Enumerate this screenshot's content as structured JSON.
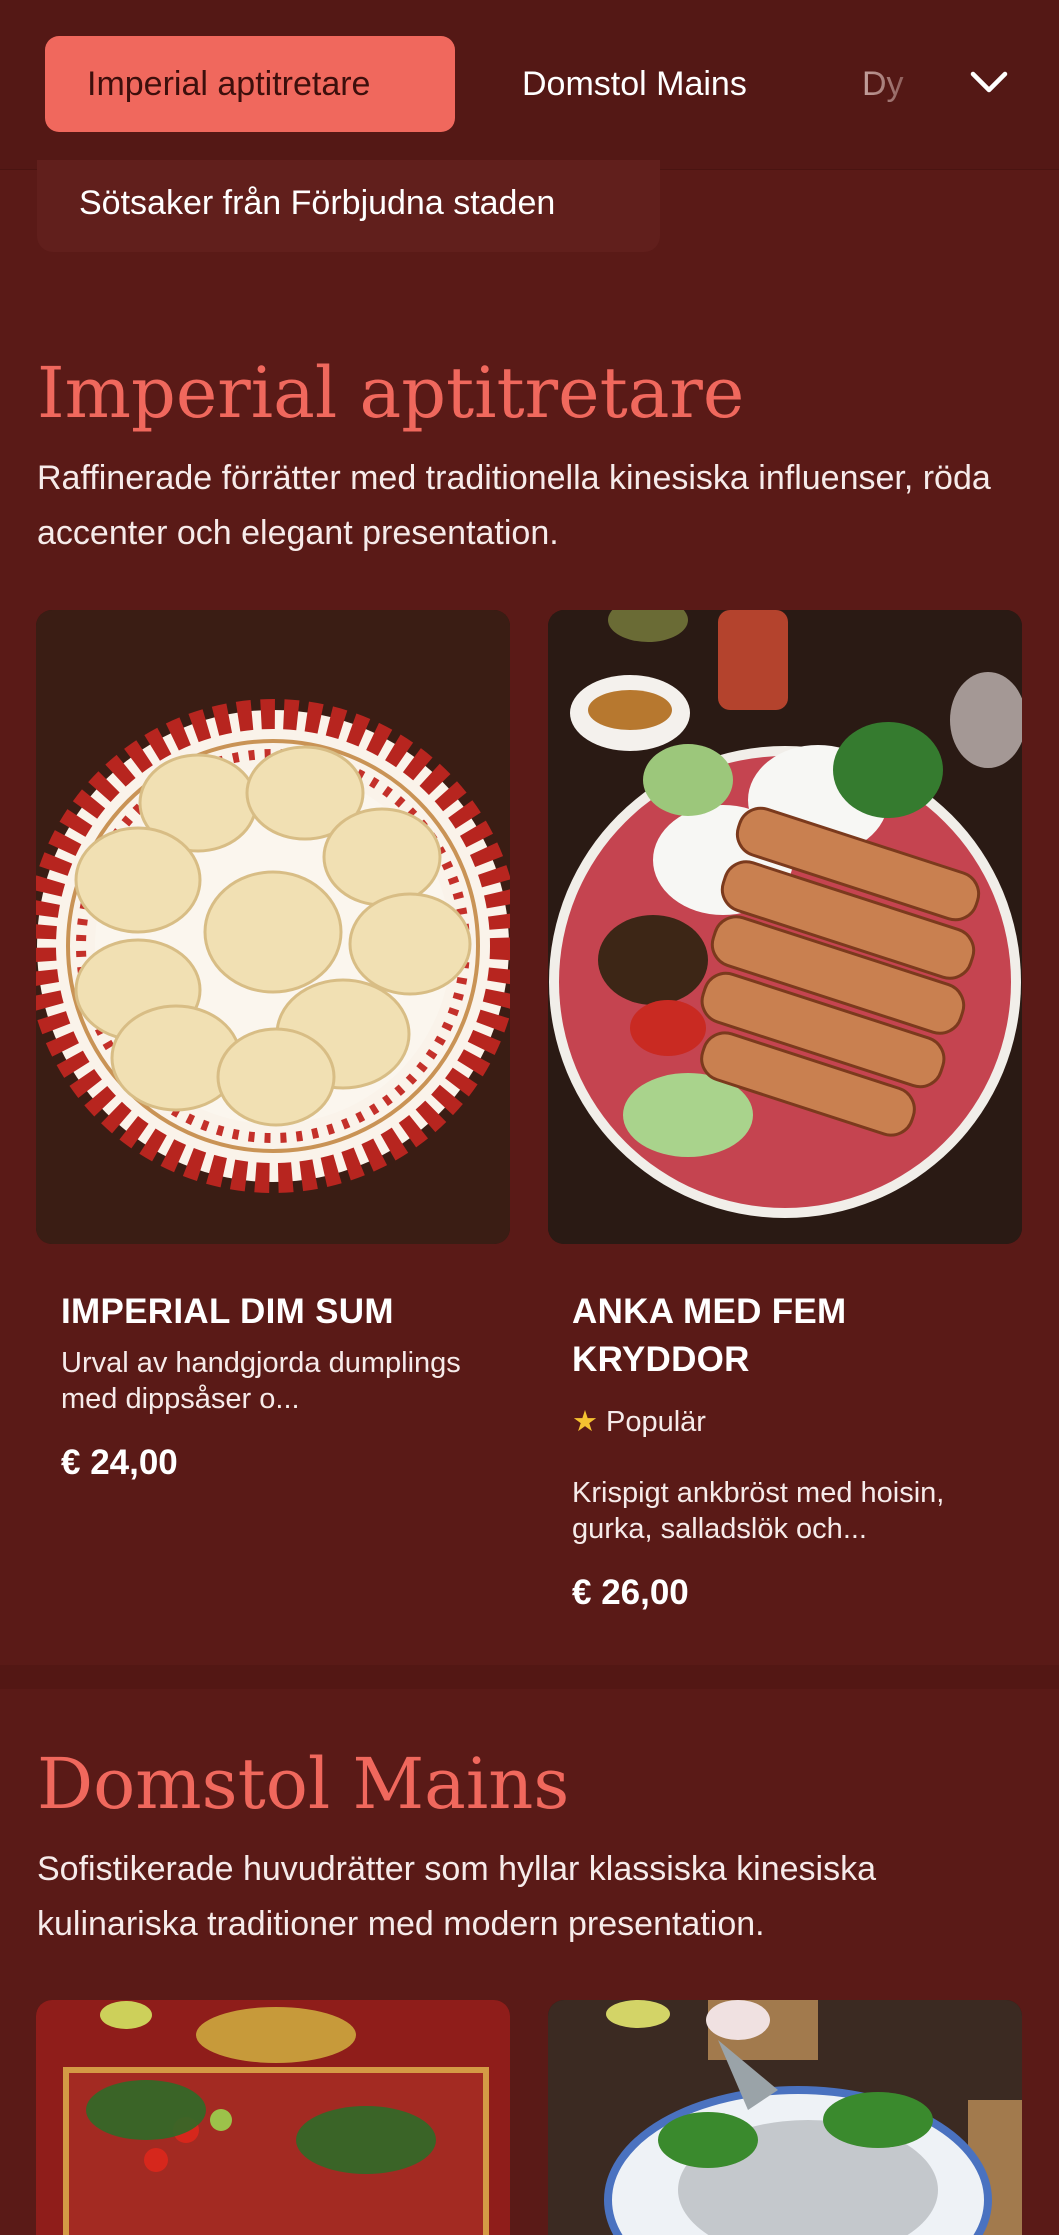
{
  "nav": {
    "tabs": [
      {
        "label": "Imperial aptitretare",
        "active": true
      },
      {
        "label": "Domstol Mains",
        "active": false
      },
      {
        "label": "Dy",
        "active": false
      }
    ],
    "expand_icon": "chevron-down-icon",
    "overflow_tab": {
      "label": "Sötsaker från Förbjudna staden"
    }
  },
  "colors": {
    "background": "#5a1a17",
    "accent": "#f0685d",
    "star": "#f5c231"
  },
  "sections": [
    {
      "title": "Imperial aptitretare",
      "description": "Raffinerade förrätter med traditionella kinesiska influenser, röda accenter och elegant presentation.",
      "items": [
        {
          "name": "IMPERIAL DIM SUM",
          "description": "Urval av handgjorda dumplings med dippsåser o...",
          "price": "€ 24,00",
          "image": "dumplings-plate"
        },
        {
          "name": "ANKA MED FEM KRYDDOR",
          "badge": "Populär",
          "badge_icon": "star-icon",
          "description": "Krispigt ankbröst med hoisin, gurka, salladslök och...",
          "price": "€ 26,00",
          "image": "duck-plate"
        }
      ]
    },
    {
      "title": "Domstol Mains",
      "description": "Sofistikerade huvudrätter som hyllar klassiska kinesiska kulinariska traditioner med modern presentation.",
      "items": [
        {
          "image": "festive-platter"
        },
        {
          "image": "steamed-fish"
        }
      ]
    }
  ]
}
